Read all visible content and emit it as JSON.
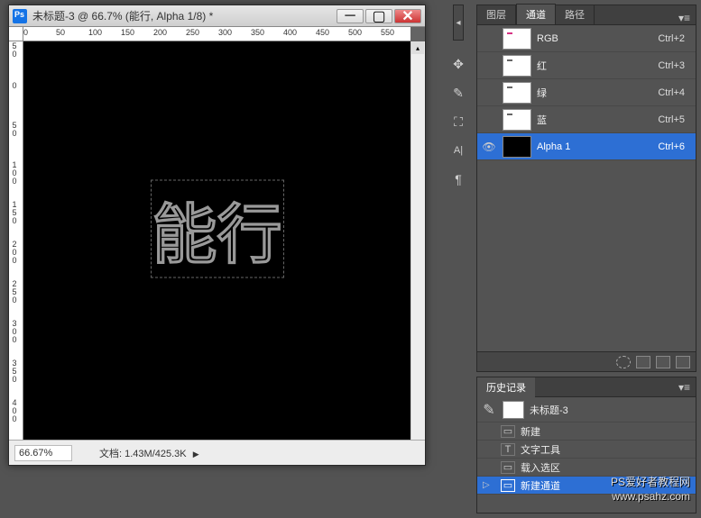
{
  "doc": {
    "title": "未标题-3 @ 66.7% (能行, Alpha 1/8) *",
    "canvas_text": "能行",
    "zoom": "66.67%",
    "status_prefix": "文档:",
    "file_size": "1.43M/425.3K",
    "ruler_h": [
      "0",
      "50",
      "100",
      "150",
      "200",
      "250",
      "300",
      "350",
      "400",
      "450",
      "500",
      "550"
    ],
    "ruler_v": [
      "50",
      "0",
      "50",
      "100",
      "150",
      "200",
      "250",
      "300",
      "350",
      "400"
    ]
  },
  "tabs": {
    "layers": "图层",
    "channels": "通道",
    "paths": "路径"
  },
  "channels": [
    {
      "name": "RGB",
      "shortcut": "Ctrl+2",
      "eye": false,
      "thumb": "white",
      "mark": "#d63384",
      "selected": false
    },
    {
      "name": "红",
      "shortcut": "Ctrl+3",
      "eye": false,
      "thumb": "white",
      "mark": "#666",
      "selected": false
    },
    {
      "name": "绿",
      "shortcut": "Ctrl+4",
      "eye": false,
      "thumb": "white",
      "mark": "#666",
      "selected": false
    },
    {
      "name": "蓝",
      "shortcut": "Ctrl+5",
      "eye": false,
      "thumb": "white",
      "mark": "#666",
      "selected": false
    },
    {
      "name": "Alpha 1",
      "shortcut": "Ctrl+6",
      "eye": true,
      "thumb": "black",
      "mark": "",
      "selected": true
    }
  ],
  "history": {
    "title": "历史记录",
    "snapshot": "未标题-3",
    "items": [
      {
        "name": "新建",
        "icon": "▭",
        "selected": false
      },
      {
        "name": "文字工具",
        "icon": "T",
        "selected": false
      },
      {
        "name": "载入选区",
        "icon": "▭",
        "selected": false
      },
      {
        "name": "新建通道",
        "icon": "▭",
        "selected": true
      }
    ]
  },
  "watermark": {
    "line1": "PS爱好者教程网",
    "line2": "www.psahz.com"
  }
}
